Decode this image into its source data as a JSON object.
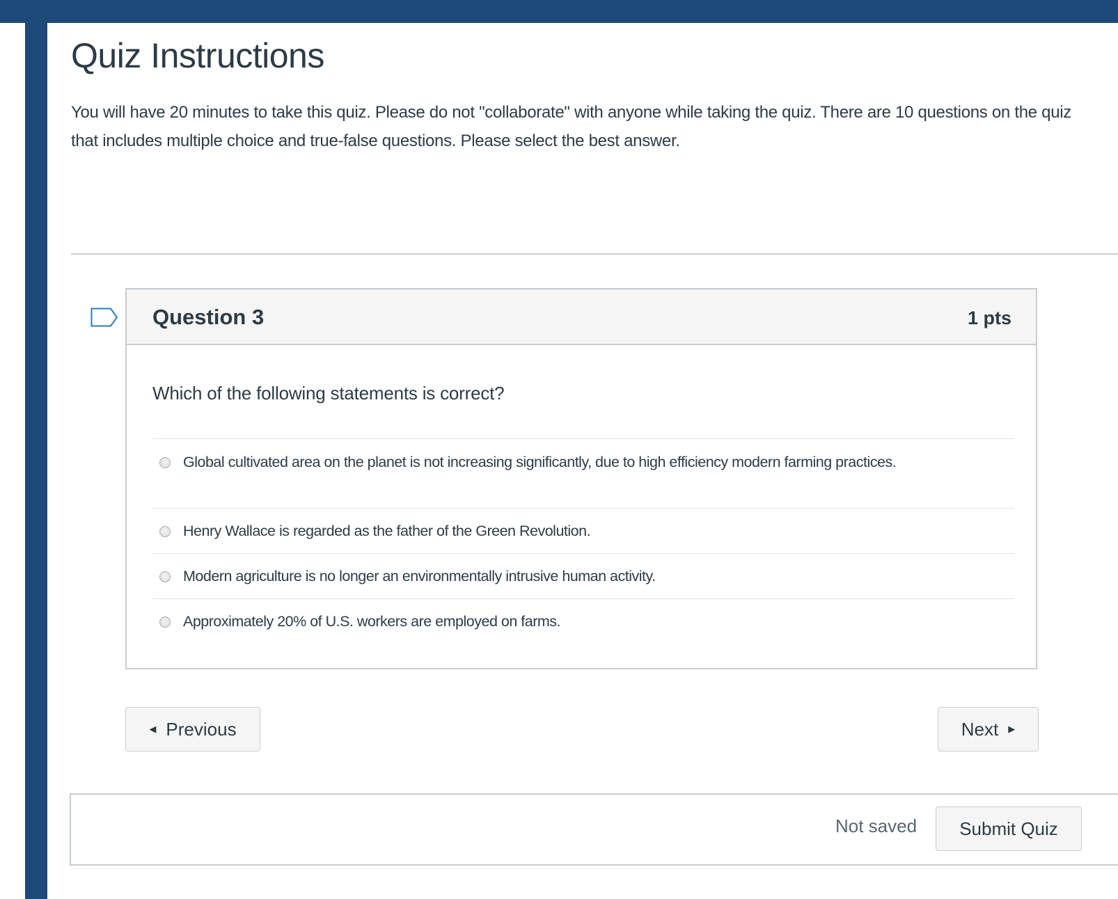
{
  "page": {
    "title": "Quiz Instructions",
    "instructions": "You will have 20 minutes to take this quiz.  Please do not \"collaborate\" with anyone while taking the quiz.  There are 10 questions on the quiz that includes multiple choice and true-false questions.  Please select the best answer."
  },
  "question": {
    "title": "Question 3",
    "points": "1 pts",
    "text": "Which of the following statements is correct?",
    "answers": [
      {
        "label": "Global cultivated area on the planet is not increasing significantly, due to high efficiency modern farming practices."
      },
      {
        "label": "Henry Wallace is regarded as the father of the Green Revolution."
      },
      {
        "label": "Modern agriculture is no longer an environmentally intrusive human activity."
      },
      {
        "label": "Approximately 20% of U.S. workers are employed on farms."
      }
    ]
  },
  "navigation": {
    "previous_label": "Previous",
    "next_label": "Next"
  },
  "footer": {
    "save_status": "Not saved",
    "submit_label": "Submit Quiz"
  },
  "icons": {
    "bookmark": "bookmark-flag-icon",
    "previous_caret": "caret-left-icon",
    "next_caret": "caret-right-icon",
    "radio": "radio-button-icon"
  },
  "colors": {
    "frame": "#1e4a7a",
    "text": "#2d3b45",
    "border": "#c7cdd1",
    "header_bg": "#f5f5f5"
  }
}
